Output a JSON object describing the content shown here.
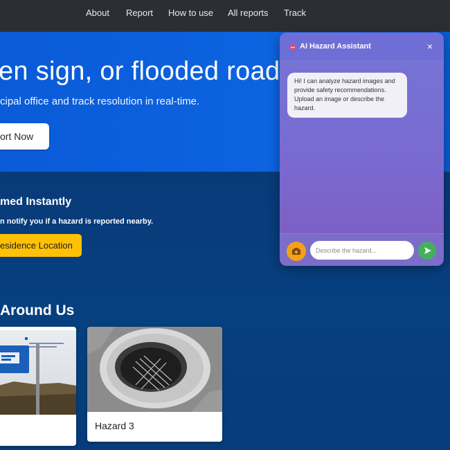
{
  "nav": {
    "items": [
      {
        "label": "About"
      },
      {
        "label": "Report"
      },
      {
        "label": "How to use"
      },
      {
        "label": "All reports"
      },
      {
        "label": "Track"
      }
    ]
  },
  "hero": {
    "title_fragment": "en sign, or flooded road",
    "subtitle_fragment": "cipal office and track resolution in real-time.",
    "report_button": "ort Now"
  },
  "notify": {
    "title_fragment": "med Instantly",
    "text_fragment": "n notify you if a hazard is reported nearby.",
    "location_button": "esidence Location"
  },
  "hazards": {
    "title_fragment": "Around Us",
    "cards": [
      {
        "caption": ""
      },
      {
        "caption": "Hazard 3"
      }
    ]
  },
  "chat": {
    "title": "AI Hazard Assistant",
    "close": "×",
    "message": "Hi! I can analyze hazard images and provide safety recommendations. Upload an image or describe the hazard.",
    "input_placeholder": "Describe the hazard...",
    "colors": {
      "upload": "#f5a01a",
      "send": "#45b05a"
    }
  }
}
